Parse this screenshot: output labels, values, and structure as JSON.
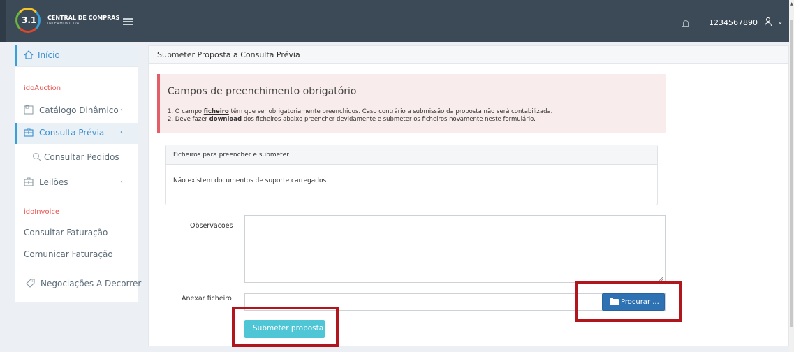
{
  "brand": {
    "badge": "3.1",
    "name": "CENTRAL DE COMPRAS",
    "subtitle": "INTERMUNICIPAL"
  },
  "header": {
    "user": "1234567890",
    "chevron": "⌄"
  },
  "sidebar": {
    "home": "Início",
    "sections": [
      {
        "title": "idoAuction"
      },
      {
        "title": "idoInvoice"
      }
    ],
    "items": {
      "catalogo": "Catálogo Dinâmico",
      "consulta_previa": "Consulta Prévia",
      "consultar_pedidos": "Consultar Pedidos",
      "leiloes": "Leilões",
      "consultar_faturacao": "Consultar Faturação",
      "comunicar_faturacao": "Comunicar Faturação",
      "negociacoes": "Negociações A Decorrer"
    },
    "caret": "‹"
  },
  "main": {
    "title": "Submeter Proposta a Consulta Prévia",
    "alert": {
      "heading": "Campos de preenchimento obrigatório",
      "line1_pre": "1. O campo ",
      "line1_bold": "ficheiro",
      "line1_post": " têm que ser obrigatoriamente preenchidos. Caso contrário a submissão da proposta não será contabilizada.",
      "line2_pre": "2. Deve fazer ",
      "line2_bold": "download",
      "line2_post": " dos ficheiros abaixo preencher devidamente e submeter os ficheiros novamente neste formulário."
    },
    "files": {
      "header": "Ficheiros para preencher e submeter",
      "empty": "Não existem documentos de suporte carregados"
    },
    "form": {
      "observacoes_label": "Observacoes",
      "observacoes_value": "",
      "anexar_label": "Anexar ficheiro",
      "anexar_value": "",
      "browse_label": "Procurar ...",
      "submit_label": "Submeter proposta"
    }
  },
  "colors": {
    "highlight": "#b0161b",
    "topbar": "#3c4a57",
    "accent_blue": "#3a8fd0",
    "submit": "#4fc6d6",
    "browse": "#2f72b3"
  }
}
